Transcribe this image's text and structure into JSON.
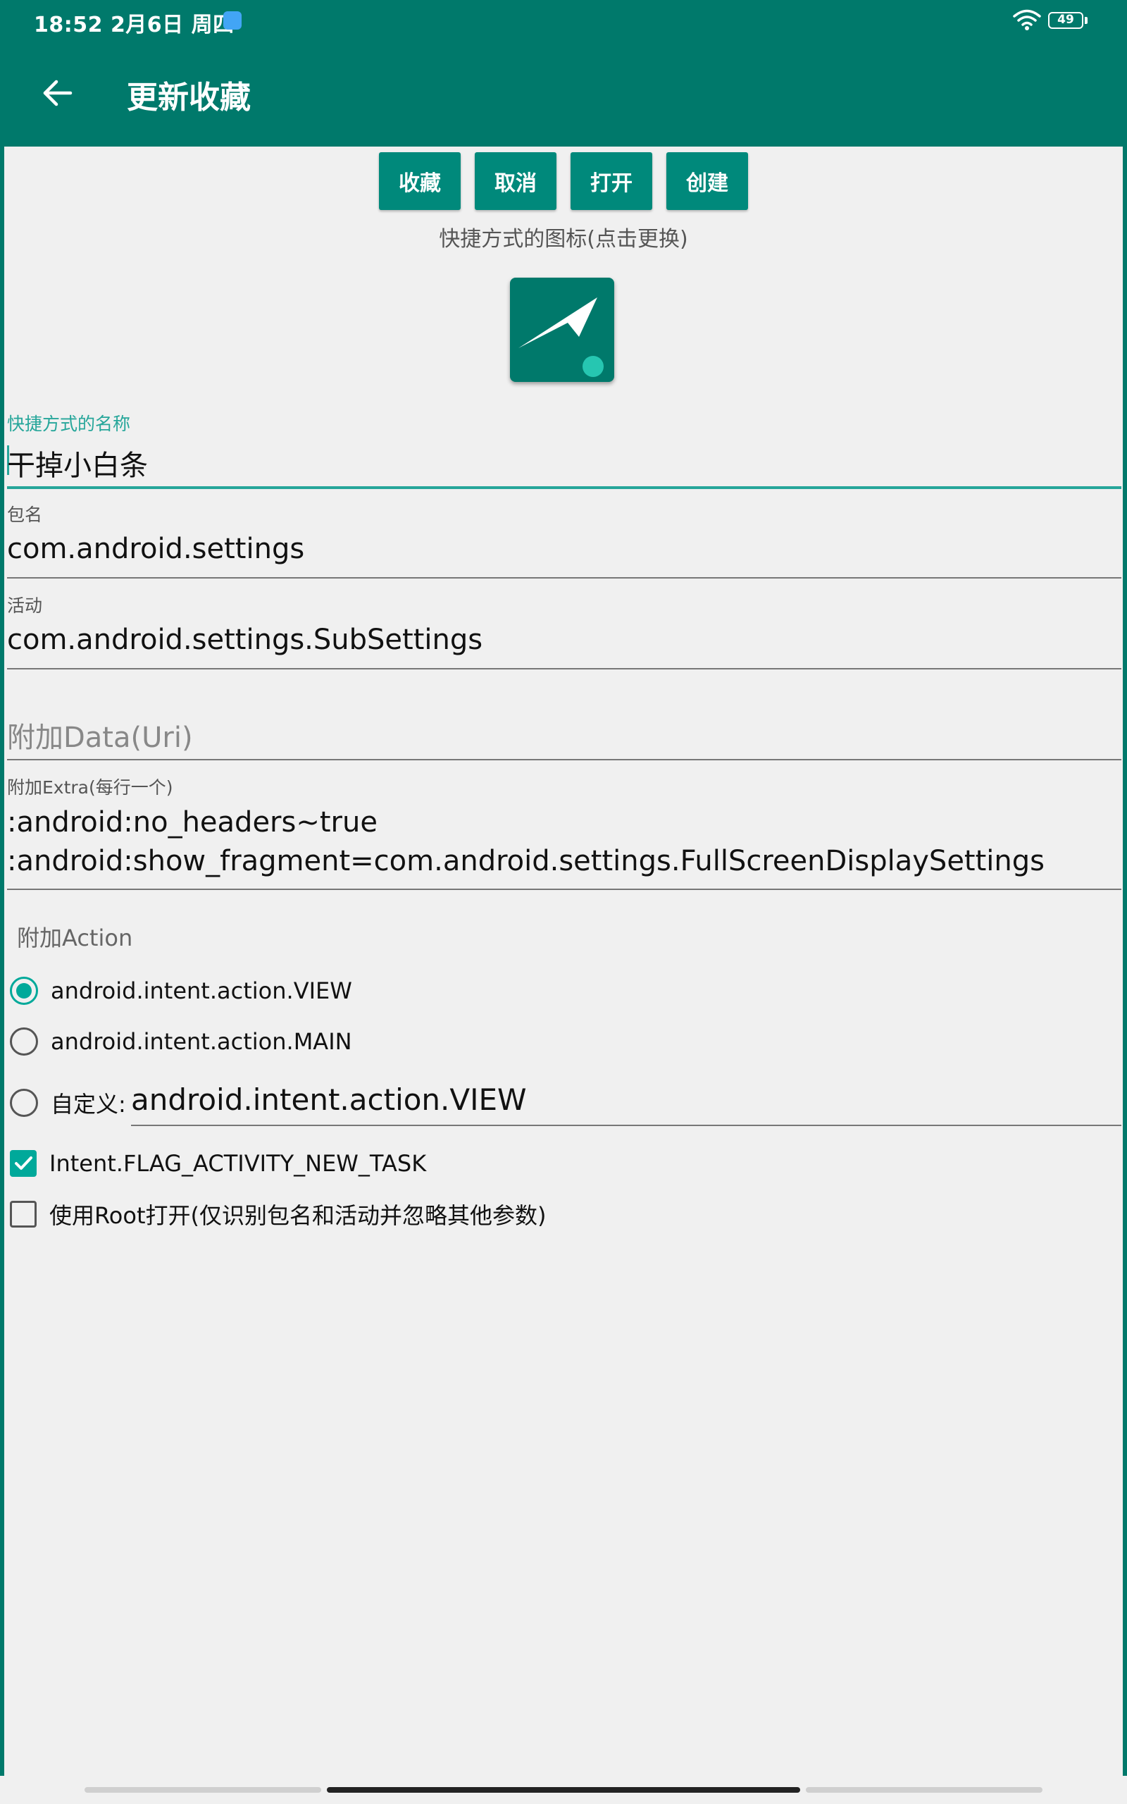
{
  "status_bar": {
    "time": "18:52 2月6日 周四",
    "battery": "49"
  },
  "app_bar": {
    "title": "更新收藏"
  },
  "actions": {
    "favorite": "收藏",
    "cancel": "取消",
    "open": "打开",
    "create": "创建"
  },
  "icon_hint": "快捷方式的图标(点击更换)",
  "fields": {
    "name": {
      "label": "快捷方式的名称",
      "value": "干掉小白条"
    },
    "package": {
      "label": "包名",
      "value": "com.android.settings"
    },
    "activity": {
      "label": "活动",
      "value": "com.android.settings.SubSettings"
    },
    "data": {
      "placeholder": "附加Data(Uri)"
    },
    "extra": {
      "label": "附加Extra(每行一个)",
      "lines": [
        ":android:no_headers~true",
        ":android:show_fragment=com.android.settings.FullScreenDisplaySettings"
      ]
    }
  },
  "action_section": {
    "label": "附加Action",
    "options": [
      {
        "label": "android.intent.action.VIEW",
        "checked": true
      },
      {
        "label": "android.intent.action.MAIN",
        "checked": false
      }
    ],
    "custom": {
      "label": "自定义:",
      "value": "android.intent.action.VIEW",
      "checked": false
    }
  },
  "flags": [
    {
      "label": "Intent.FLAG_ACTIVITY_NEW_TASK",
      "checked": true
    },
    {
      "label": "使用Root打开(仅识别包名和活动并忽略其他参数)",
      "checked": false
    }
  ],
  "colors": {
    "primary": "#00796b",
    "accent": "#26a69a",
    "button": "#00897b",
    "background": "#f0f0f0"
  },
  "icons": [
    "wifi-icon",
    "battery-icon",
    "back-arrow-icon",
    "shortcut-arrow-icon"
  ]
}
